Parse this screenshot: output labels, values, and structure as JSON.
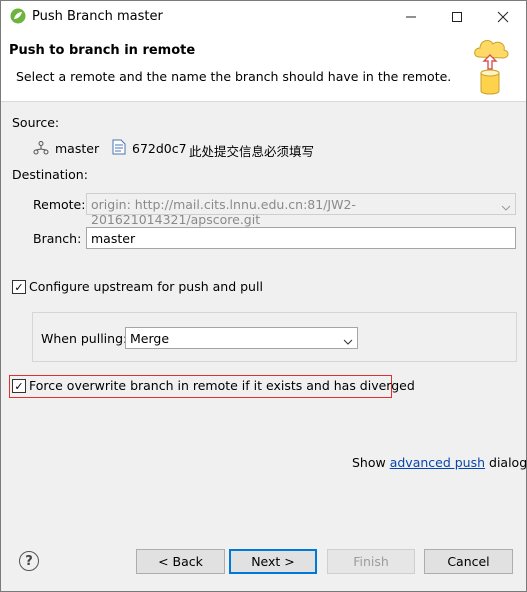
{
  "window": {
    "title": "Push Branch master"
  },
  "header": {
    "title": "Push to branch in remote",
    "subtitle": "Select a remote and the name the branch should have in the remote."
  },
  "source": {
    "label": "Source:",
    "branch": "master",
    "commit_id": "672d0c7",
    "commit_message": "此处提交信息必须填写"
  },
  "destination": {
    "label": "Destination:",
    "remote_label": "Remote:",
    "remote_value": "origin: http://mail.cits.lnnu.edu.cn:81/JW2-201621014321/apscore.git",
    "branch_label": "Branch:",
    "branch_value": "master"
  },
  "upstream": {
    "label": "Configure upstream for push and pull",
    "checked": true,
    "when_pulling_label": "When pulling:",
    "when_pulling_value": "Merge"
  },
  "force": {
    "label": "Force overwrite branch in remote if it exists and has diverged",
    "checked": true,
    "highlight_color": "#e03030"
  },
  "advanced": {
    "prefix": "Show ",
    "link": "advanced push",
    "suffix": " dialog"
  },
  "buttons": {
    "back": "< Back",
    "next": "Next >",
    "finish": "Finish",
    "cancel": "Cancel"
  },
  "icons": {
    "app": "spring-leaf-icon",
    "help": "help-icon",
    "banner": "cloud-database-push-icon"
  },
  "colors": {
    "accent": "#0078d7",
    "link": "#0645ad"
  }
}
